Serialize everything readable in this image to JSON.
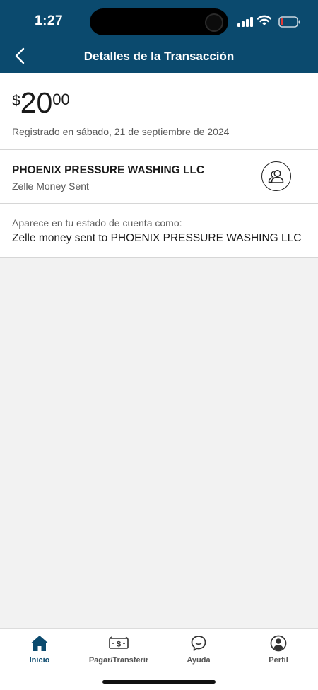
{
  "status_bar": {
    "time": "1:27"
  },
  "nav": {
    "title": "Detalles de la Transacción"
  },
  "transaction": {
    "amount_currency": "$",
    "amount_whole": "20",
    "amount_cents": "00",
    "registered": "Registrado en sábado, 21 de septiembre de 2024",
    "merchant_name": "PHOENIX PRESSURE WASHING LLC",
    "merchant_sub": "Zelle Money Sent",
    "statement_label": "Aparece en tu estado de cuenta como:",
    "statement_value": "Zelle money sent to PHOENIX PRESSURE WASHING LLC"
  },
  "tabs": [
    {
      "label": "Inicio",
      "icon": "home-icon",
      "active": true
    },
    {
      "label": "Pagar/Transferir",
      "icon": "money-transfer-icon",
      "active": false
    },
    {
      "label": "Ayuda",
      "icon": "chat-bubble-icon",
      "active": false
    },
    {
      "label": "Perfil",
      "icon": "profile-icon",
      "active": false
    }
  ],
  "colors": {
    "header": "#0b4a6e",
    "active_tab": "#0b4a6e",
    "battery_low": "#e53935"
  }
}
